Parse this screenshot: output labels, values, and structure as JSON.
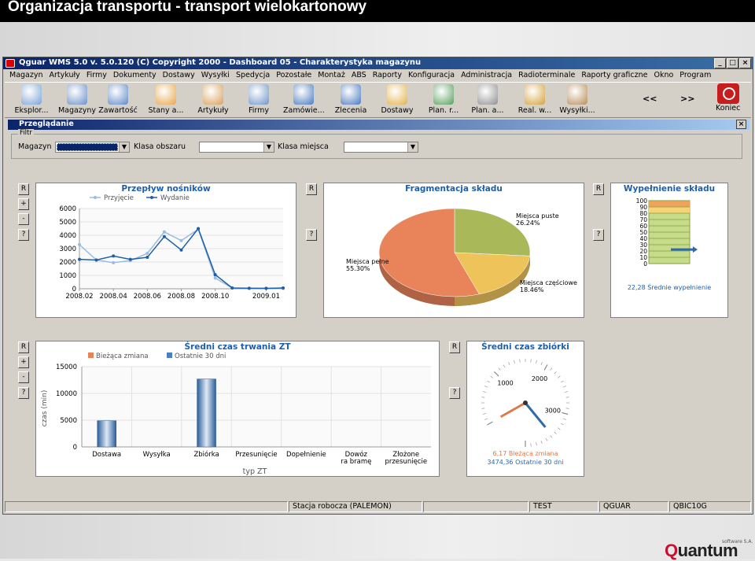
{
  "slide": {
    "title": "Organizacja transportu - transport wielokartonowy"
  },
  "window": {
    "title": "Qguar WMS 5.0  v. 5.0.120    (C) Copyright 2000  - Dashboard 05 - Charakterystyka magazynu"
  },
  "menu": [
    "Magazyn",
    "Artykuły",
    "Firmy",
    "Dokumenty",
    "Dostawy",
    "Wysyłki",
    "Spedycja",
    "Pozostałe",
    "Montaż",
    "ABS",
    "Raporty",
    "Konfiguracja",
    "Administracja",
    "Radioterminale",
    "Raporty graficzne",
    "Okno",
    "Program"
  ],
  "toolbar": [
    {
      "label": "Eksplor...",
      "icon": "magnifier-icon"
    },
    {
      "label": "Magazyny",
      "icon": "warehouse-icon"
    },
    {
      "label": "Zawartość",
      "icon": "warehouse-contents-icon"
    },
    {
      "label": "Stany a...",
      "icon": "stock-gauge-icon"
    },
    {
      "label": "Artykuły",
      "icon": "box-icon"
    },
    {
      "label": "Firmy",
      "icon": "company-card-icon"
    },
    {
      "label": "Zamówie...",
      "icon": "order-person-icon"
    },
    {
      "label": "Zlecenia",
      "icon": "task-person-icon"
    },
    {
      "label": "Dostawy",
      "icon": "delivery-icon"
    },
    {
      "label": "Plan. r...",
      "icon": "plan-gear-icon"
    },
    {
      "label": "Plan. a...",
      "icon": "plan-clock-icon"
    },
    {
      "label": "Real. w...",
      "icon": "truck-icon"
    },
    {
      "label": "Wysyłki...",
      "icon": "shipment-lock-icon"
    }
  ],
  "nav": {
    "prev": "<<",
    "next": ">>"
  },
  "koniec": {
    "label": "Koniec",
    "icon": "power-icon"
  },
  "child": {
    "title": "Przeglądanie",
    "close": "×"
  },
  "filter": {
    "title": "Filtr",
    "magazyn_label": "Magazyn",
    "klasa_obszaru_label": "Klasa obszaru",
    "klasa_miejsca_label": "Klasa miejsca",
    "dropdown_arrow": "▼"
  },
  "side_buttons": {
    "r": "R",
    "plus": "+",
    "minus": "-",
    "help": "?"
  },
  "charts": {
    "przeplyw": {
      "title": "Przepływ nośników",
      "type": "line",
      "series": [
        {
          "name": "Przyjęcie",
          "color": "#9bbbe0",
          "values": [
            3300,
            2150,
            1950,
            2100,
            2650,
            4250,
            3600,
            4450,
            800,
            50,
            30,
            40,
            20
          ]
        },
        {
          "name": "Wydanie",
          "color": "#1f5fa8",
          "values": [
            2200,
            2150,
            2450,
            2200,
            2350,
            3900,
            2900,
            4500,
            1050,
            60,
            40,
            30,
            60
          ]
        }
      ],
      "x_ticks": [
        "2008.02",
        "2008.04",
        "2008.06",
        "2008.08",
        "2008.10",
        "2009.01"
      ],
      "y_ticks": [
        "0",
        "1000",
        "2000",
        "3000",
        "4000",
        "5000",
        "6000"
      ],
      "ylim": [
        0,
        6000
      ]
    },
    "fragmentacja": {
      "title": "Fragmentacja składu",
      "type": "pie",
      "slices": [
        {
          "label": "Miejsca puste",
          "value": 26.24,
          "value_label": "26.24%",
          "color": "#a9b95a"
        },
        {
          "label": "Miejsca częściowe",
          "value": 18.46,
          "value_label": "18.46%",
          "color": "#edc35a"
        },
        {
          "label": "Miejsca pełne",
          "value": 55.3,
          "value_label": "55.30%",
          "color": "#e9845a"
        }
      ],
      "label_puste": "Miejsca puste",
      "value_puste": "26.24%",
      "label_czesciowe": "Miejsca częściowe",
      "value_czesciowe": "18.46%",
      "label_pelne": "Miejsca pełne",
      "value_pelne": "55.30%"
    },
    "wypelnienie": {
      "title": "Wypełnienie składu",
      "type": "gauge",
      "value": 22.28,
      "caption": "22,28 Średnie wypełnienie",
      "ticks": [
        "100",
        "90",
        "80",
        "70",
        "60",
        "50",
        "40",
        "30",
        "20",
        "10",
        "0"
      ]
    },
    "czas_zt": {
      "title": "Średni czas trwania ZT",
      "type": "bar",
      "legend": [
        "Bieżąca zmiana",
        "Ostatnie 30 dni"
      ],
      "categories": [
        "Dostawa",
        "Wysyłka",
        "Zbiórka",
        "Przesunięcie",
        "Dopełnienie",
        "Dowóz ra bramę",
        "Złożone przesunięcie"
      ],
      "cat_line1": [
        "Dostawa",
        "Wysyłka",
        "Zbiórka",
        "Przesunięcie",
        "Dopełnienie",
        "Dowóz",
        "Złożone"
      ],
      "cat_line2": [
        "",
        "",
        "",
        "",
        "",
        "ra bramę",
        "przesunięcie"
      ],
      "series": [
        {
          "name": "Bieżąca zmiana",
          "values": [
            0,
            0,
            0,
            0,
            0,
            0,
            0
          ]
        },
        {
          "name": "Ostatnie 30 dni",
          "values": [
            4900,
            0,
            12700,
            0,
            0,
            0,
            0
          ]
        }
      ],
      "y_ticks": [
        "0",
        "5000",
        "10000",
        "15000"
      ],
      "ylim": [
        0,
        15000
      ],
      "ylabel": "czas (min)",
      "xlabel": "typ ZT"
    },
    "czas_zbiorki": {
      "title": "Średni czas zbiórki",
      "type": "gauge",
      "dial_labels": [
        "1000",
        "2000",
        "3000"
      ],
      "current": 6.17,
      "last30": 3474.36,
      "caption_current": "6,17 Bieżąca zmiana",
      "caption_last30": "3474,36 Ostatnie 30 dni"
    }
  },
  "status": [
    "",
    "Stacja robocza (PALEMON)",
    "",
    "TEST",
    "QGUAR",
    "QBIC10G"
  ],
  "logo": {
    "text_q": "Q",
    "text_rest": "uantum",
    "sub": "software S.A."
  },
  "colors": {
    "accent_blue": "#1c5fae",
    "title_bar": "#0a246a",
    "bar_blue": "#4a7fc1",
    "orange": "#e9845a"
  }
}
